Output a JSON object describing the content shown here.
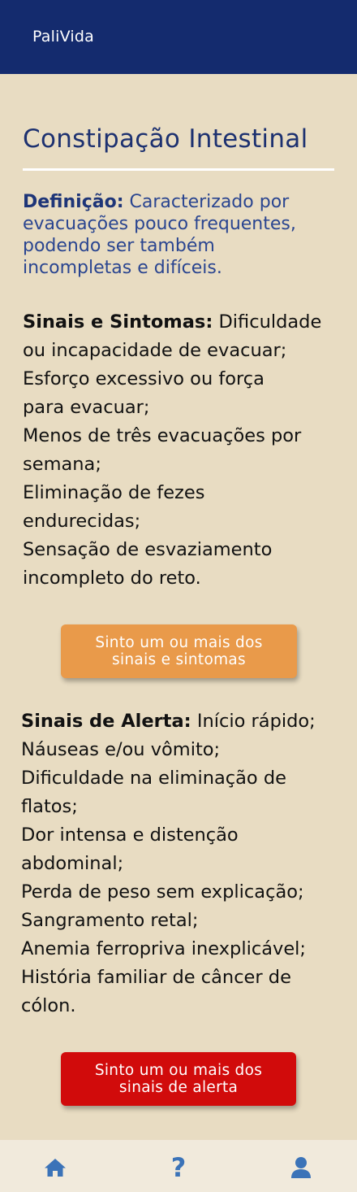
{
  "app": {
    "title": "PaliVida"
  },
  "page": {
    "title": "Constipação Intestinal"
  },
  "definition": {
    "label": "Definição:",
    "lines": [
      " Caracterizado por",
      "evacuações pouco frequentes,",
      "podendo ser também",
      "incompletas e difíceis."
    ]
  },
  "symptoms": {
    "label": "Sinais e Sintomas:",
    "lines": [
      " Dificuldade",
      "ou incapacidade de evacuar;",
      "Esforço excessivo ou força",
      "para evacuar;",
      "Menos de três evacuações por",
      "semana;",
      "Eliminação de fezes",
      "endurecidas;",
      "Sensação de esvaziamento",
      "incompleto do reto."
    ]
  },
  "symptoms_button": {
    "line1": "Sinto um ou mais dos",
    "line2": "sinais e sintomas"
  },
  "alerts": {
    "label": "Sinais de Alerta:",
    "lines": [
      " Início rápido;",
      "Náuseas e/ou vômito;",
      "Dificuldade na eliminação de",
      "flatos;",
      "Dor intensa e distenção",
      "abdominal;",
      "Perda de peso sem explicação;",
      "Sangramento retal;",
      "Anemia ferropriva inexplicável;",
      "História familiar de câncer de",
      "cólon."
    ]
  },
  "alert_button": {
    "line1": "Sinto um ou mais dos",
    "line2": "sinais de alerta"
  },
  "nav": {
    "home_icon": "home-icon",
    "help_icon": "question-mark-icon",
    "help_glyph": "?",
    "profile_icon": "user-icon"
  },
  "colors": {
    "header": "#142b6e",
    "background": "#e8dcc2",
    "title": "#1d3170",
    "definition_text": "#2a4590",
    "symptoms_button": "#e99a4a",
    "alert_button": "#d10b0b",
    "nav_icon": "#3b73b8",
    "bottom_nav": "#f1eadc"
  }
}
